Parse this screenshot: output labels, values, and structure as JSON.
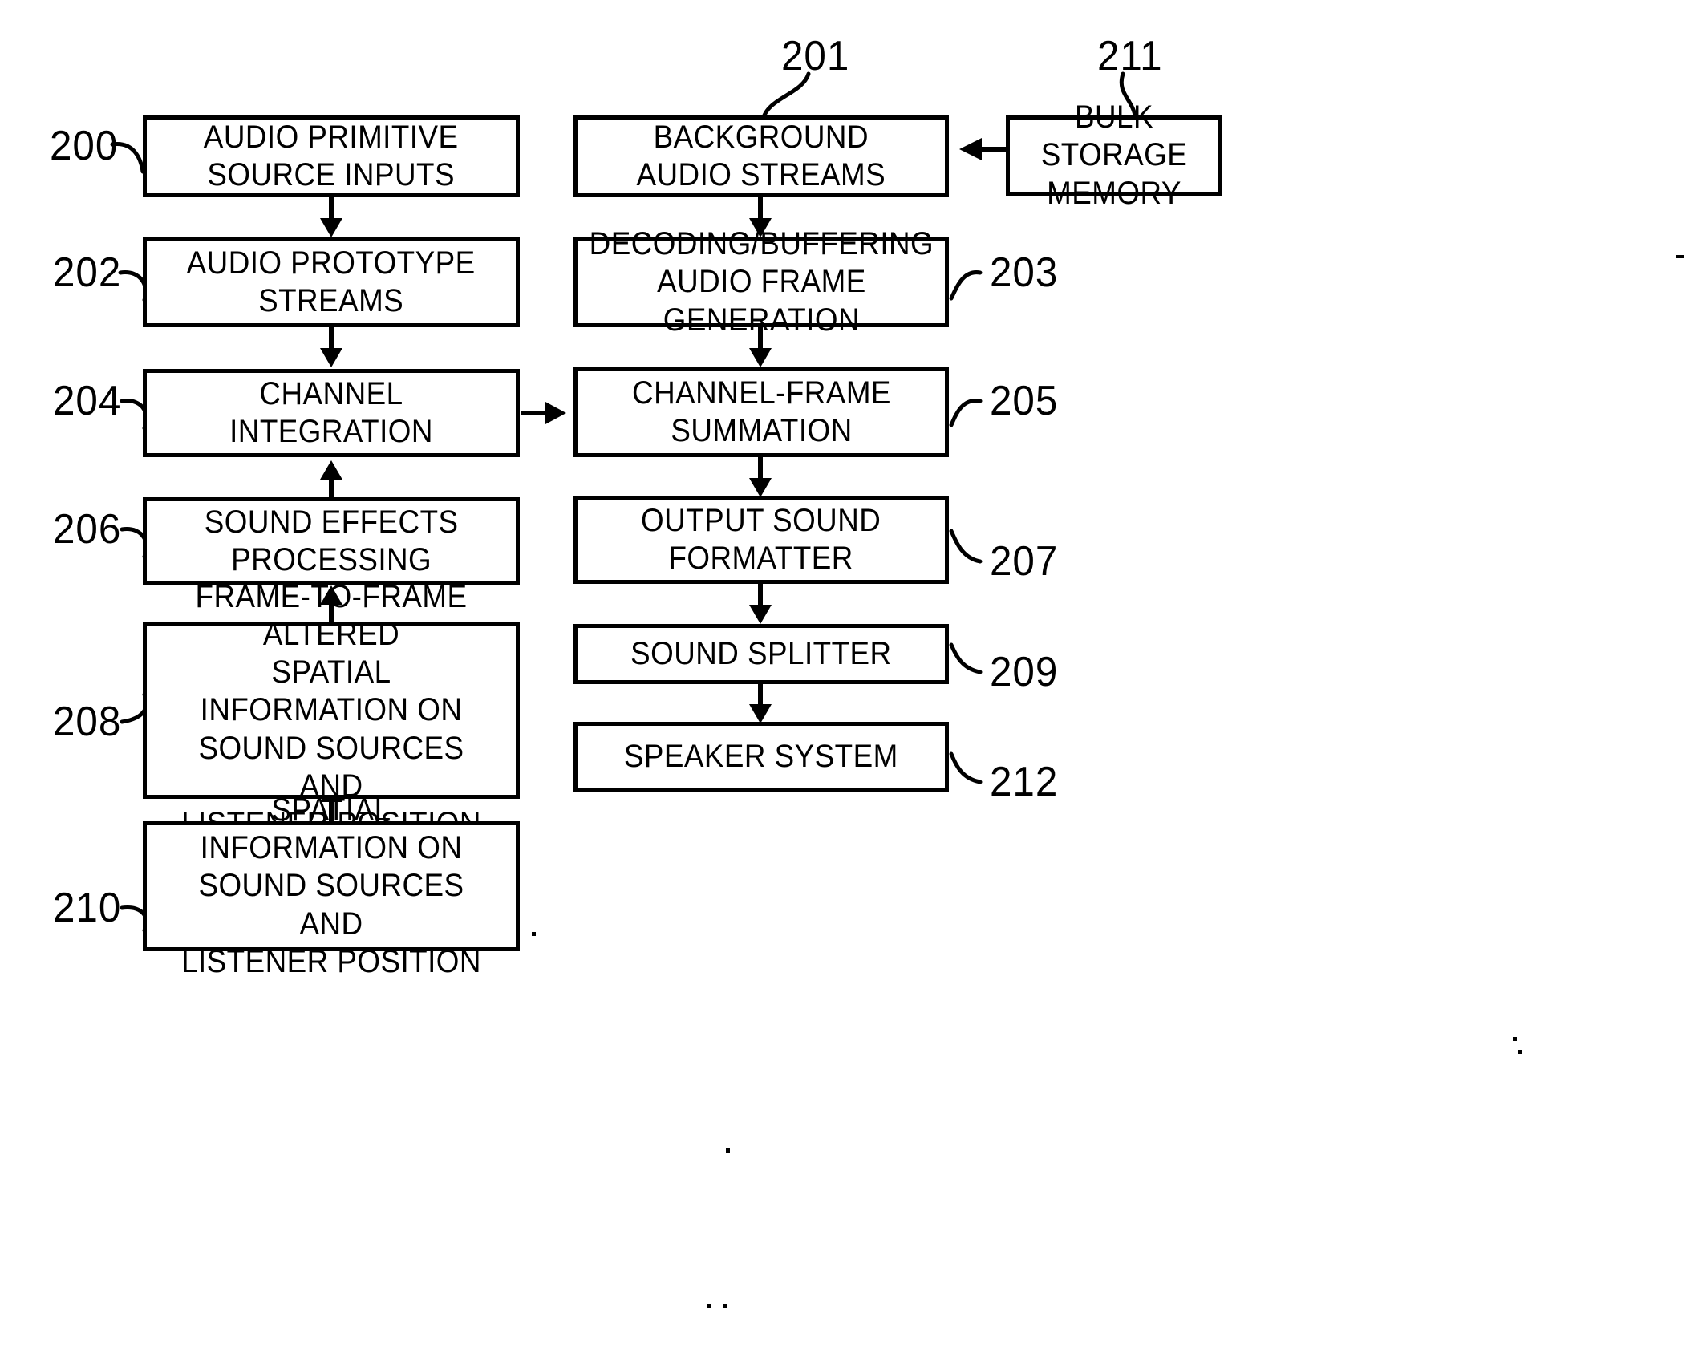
{
  "figure": {
    "type": "patent-block-diagram",
    "background_color": "#ffffff",
    "line_color": "#000000"
  },
  "blocks": [
    {
      "id": "200",
      "label": "AUDIO PRIMITIVE\nSOURCE INPUTS",
      "ref": "200",
      "ref_side": "left"
    },
    {
      "id": "202",
      "label": "AUDIO PROTOTYPE\nSTREAMS",
      "ref": "202",
      "ref_side": "left"
    },
    {
      "id": "204",
      "label": "CHANNEL INTEGRATION",
      "ref": "204",
      "ref_side": "left"
    },
    {
      "id": "206",
      "label": "SOUND EFFECTS\nPROCESSING",
      "ref": "206",
      "ref_side": "left"
    },
    {
      "id": "208",
      "label": "FRAME-TO-FRAME ALTERED\nSPATIAL INFORMATION ON\nSOUND SOURCES AND\nLISTENER POSITION",
      "ref": "208",
      "ref_side": "left"
    },
    {
      "id": "210",
      "label": "SPATIAL INFORMATION ON\nSOUND SOURCES AND\nLISTENER POSITION",
      "ref": "210",
      "ref_side": "left"
    },
    {
      "id": "201",
      "label": "BACKGROUND\nAUDIO STREAMS",
      "ref": "201",
      "ref_side": "top"
    },
    {
      "id": "203",
      "label": "DECODING/BUFFERING\nAUDIO FRAME GENERATION",
      "ref": "203",
      "ref_side": "right"
    },
    {
      "id": "205",
      "label": "CHANNEL-FRAME\nSUMMATION",
      "ref": "205",
      "ref_side": "right"
    },
    {
      "id": "207",
      "label": "OUTPUT SOUND\nFORMATTER",
      "ref": "207",
      "ref_side": "right"
    },
    {
      "id": "209",
      "label": "SOUND SPLITTER",
      "ref": "209",
      "ref_side": "right"
    },
    {
      "id": "212",
      "label": "SPEAKER SYSTEM",
      "ref": "212",
      "ref_side": "right"
    },
    {
      "id": "211",
      "label": "BULK STORAGE\nMEMORY",
      "ref": "211",
      "ref_side": "top"
    }
  ],
  "reference_numerals": {
    "n200": "200",
    "n201": "201",
    "n202": "202",
    "n203": "203",
    "n204": "204",
    "n205": "205",
    "n206": "206",
    "n207": "207",
    "n208": "208",
    "n209": "209",
    "n210": "210",
    "n211": "211",
    "n212": "212"
  },
  "labels": {
    "b200": "AUDIO PRIMITIVE\nSOURCE INPUTS",
    "b201": "BACKGROUND\nAUDIO STREAMS",
    "b202": "AUDIO PROTOTYPE\nSTREAMS",
    "b203": "DECODING/BUFFERING\nAUDIO FRAME GENERATION",
    "b204": "CHANNEL INTEGRATION",
    "b205": "CHANNEL-FRAME\nSUMMATION",
    "b206": "SOUND EFFECTS\nPROCESSING",
    "b207": "OUTPUT SOUND\nFORMATTER",
    "b208": "FRAME-TO-FRAME ALTERED\nSPATIAL INFORMATION ON\nSOUND SOURCES AND\nLISTENER POSITION",
    "b209": "SOUND SPLITTER",
    "b210": "SPATIAL INFORMATION ON\nSOUND SOURCES AND\nLISTENER POSITION",
    "b211": "BULK STORAGE\nMEMORY",
    "b212": "SPEAKER SYSTEM"
  },
  "connections": [
    {
      "from": "200",
      "to": "202",
      "direction": "down"
    },
    {
      "from": "202",
      "to": "204",
      "direction": "down"
    },
    {
      "from": "206",
      "to": "204",
      "direction": "up"
    },
    {
      "from": "208",
      "to": "206",
      "direction": "up"
    },
    {
      "from": "210",
      "to": "208",
      "direction": "up"
    },
    {
      "from": "204",
      "to": "205",
      "direction": "right"
    },
    {
      "from": "211",
      "to": "201",
      "direction": "left"
    },
    {
      "from": "201",
      "to": "203",
      "direction": "down"
    },
    {
      "from": "203",
      "to": "205",
      "direction": "down"
    },
    {
      "from": "205",
      "to": "207",
      "direction": "down"
    },
    {
      "from": "207",
      "to": "209",
      "direction": "down"
    },
    {
      "from": "209",
      "to": "212",
      "direction": "down"
    }
  ]
}
